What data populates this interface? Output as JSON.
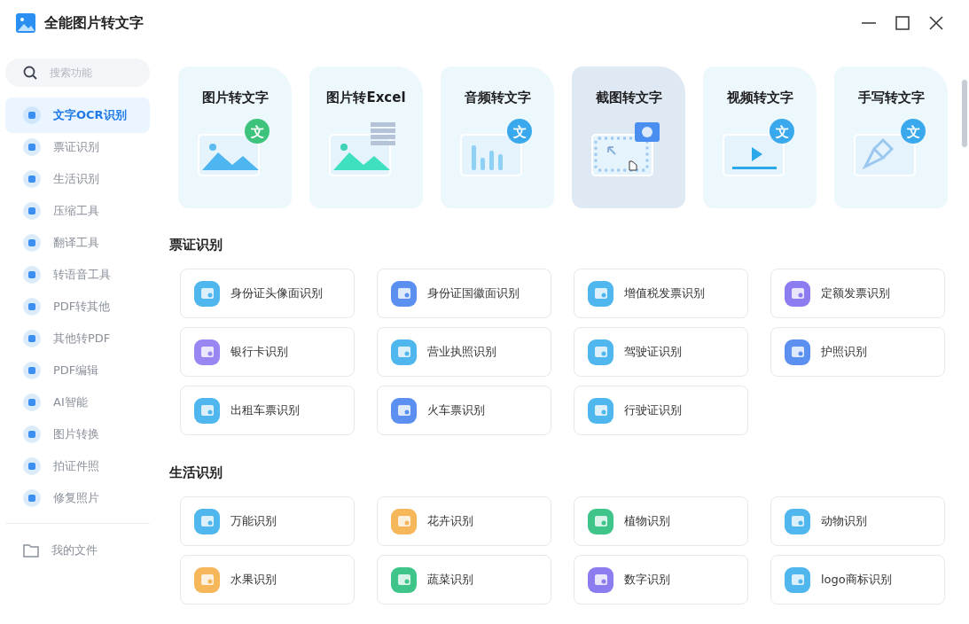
{
  "window": {
    "title": "全能图片转文字"
  },
  "search": {
    "placeholder": "搜索功能"
  },
  "sidebar": {
    "items": [
      {
        "label": "文字OCR识别",
        "selected": true
      },
      {
        "label": "票证识别",
        "selected": false
      },
      {
        "label": "生活识别",
        "selected": false
      },
      {
        "label": "压缩工具",
        "selected": false
      },
      {
        "label": "翻译工具",
        "selected": false
      },
      {
        "label": "转语音工具",
        "selected": false
      },
      {
        "label": "PDF转其他",
        "selected": false
      },
      {
        "label": "其他转PDF",
        "selected": false
      },
      {
        "label": "PDF编辑",
        "selected": false
      },
      {
        "label": "AI智能",
        "selected": false
      },
      {
        "label": "图片转换",
        "selected": false
      },
      {
        "label": "拍证件照",
        "selected": false
      },
      {
        "label": "修复照片",
        "selected": false
      }
    ],
    "footer": {
      "label": "我的文件"
    }
  },
  "feature_cards": [
    {
      "title": "图片转文字",
      "kind": "image",
      "badge": "文",
      "highlighted": false
    },
    {
      "title": "图片转Excel",
      "kind": "excel",
      "highlighted": false
    },
    {
      "title": "音频转文字",
      "kind": "audio",
      "badge": "文",
      "highlighted": false
    },
    {
      "title": "截图转文字",
      "kind": "screenshot",
      "highlighted": true
    },
    {
      "title": "视频转文字",
      "kind": "video",
      "badge": "文",
      "highlighted": false
    },
    {
      "title": "手写转文字",
      "kind": "handwriting",
      "badge": "文",
      "highlighted": false
    }
  ],
  "sections": [
    {
      "title": "票证识别",
      "tools": [
        {
          "label": "身份证头像面识别",
          "color": "#4fb6ee"
        },
        {
          "label": "身份证国徽面识别",
          "color": "#5b8ff0"
        },
        {
          "label": "增值税发票识别",
          "color": "#4fb6ee"
        },
        {
          "label": "定额发票识别",
          "color": "#8b7cf0"
        },
        {
          "label": "银行卡识别",
          "color": "#9a86f2"
        },
        {
          "label": "营业执照识别",
          "color": "#4fb6ee"
        },
        {
          "label": "驾驶证识别",
          "color": "#4fb6ee"
        },
        {
          "label": "护照识别",
          "color": "#5b8ff0"
        },
        {
          "label": "出租车票识别",
          "color": "#4fb6ee"
        },
        {
          "label": "火车票识别",
          "color": "#5b8ff0"
        },
        {
          "label": "行驶证识别",
          "color": "#4fb6ee"
        }
      ]
    },
    {
      "title": "生活识别",
      "tools": [
        {
          "label": "万能识别",
          "color": "#4fb6ee"
        },
        {
          "label": "花卉识别",
          "color": "#f5b75a"
        },
        {
          "label": "植物识别",
          "color": "#3fc48a"
        },
        {
          "label": "动物识别",
          "color": "#4fb6ee"
        },
        {
          "label": "水果识别",
          "color": "#f5b75a"
        },
        {
          "label": "蔬菜识别",
          "color": "#3fc48a"
        },
        {
          "label": "数字识别",
          "color": "#8b7cf0"
        },
        {
          "label": "logo商标识别",
          "color": "#4fb6ee"
        }
      ]
    }
  ]
}
